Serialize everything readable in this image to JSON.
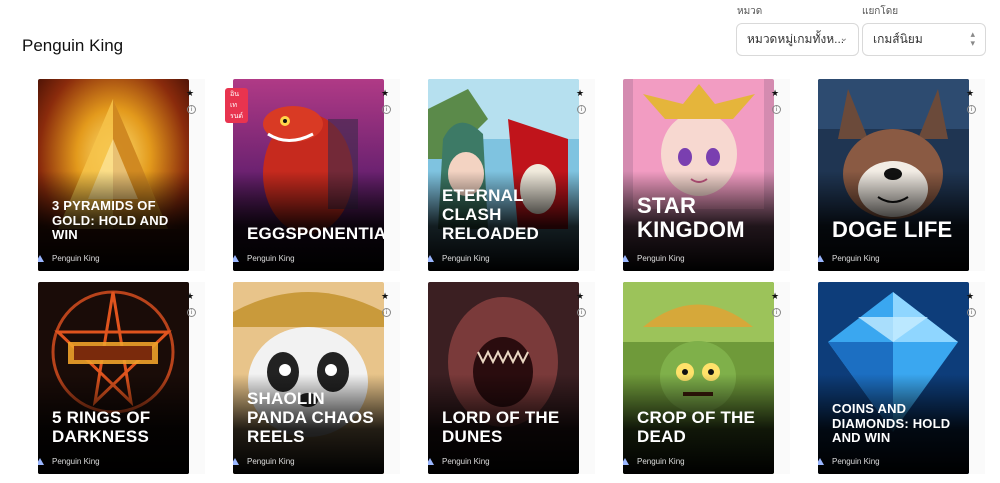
{
  "page": {
    "title": "Penguin King"
  },
  "filters": {
    "category": {
      "label": "หมวด",
      "value": "หมวดหมู่เกมทั้งห..."
    },
    "sort": {
      "label": "แยกโดย",
      "value": "เกมส์นิยม"
    }
  },
  "games": [
    {
      "name": "3 PYRAMIDS OF GOLD: HOLD AND WIN",
      "provider": "Penguin King",
      "badge": ""
    },
    {
      "name": "EGGSPONENTIAL",
      "provider": "Penguin King",
      "badge": "อินเทรนด์"
    },
    {
      "name": "ETERNAL CLASH RELOADED",
      "provider": "Penguin King",
      "badge": ""
    },
    {
      "name": "STAR KINGDOM",
      "provider": "Penguin King",
      "badge": ""
    },
    {
      "name": "DOGE LIFE",
      "provider": "Penguin King",
      "badge": ""
    },
    {
      "name": "5 RINGS OF DARKNESS",
      "provider": "Penguin King",
      "badge": ""
    },
    {
      "name": "SHAOLIN PANDA CHAOS REELS",
      "provider": "Penguin King",
      "badge": ""
    },
    {
      "name": "LORD OF THE DUNES",
      "provider": "Penguin King",
      "badge": ""
    },
    {
      "name": "CROP OF THE DEAD",
      "provider": "Penguin King",
      "badge": ""
    },
    {
      "name": "COINS AND DIAMONDS: HOLD AND WIN",
      "provider": "Penguin King",
      "badge": ""
    }
  ],
  "icons": {
    "favorite": "star-icon",
    "info": "info-icon",
    "provider_logo": "penguin-logo-icon"
  },
  "colors": {
    "badge": "#e8344f",
    "card_text": "#ffffff"
  }
}
